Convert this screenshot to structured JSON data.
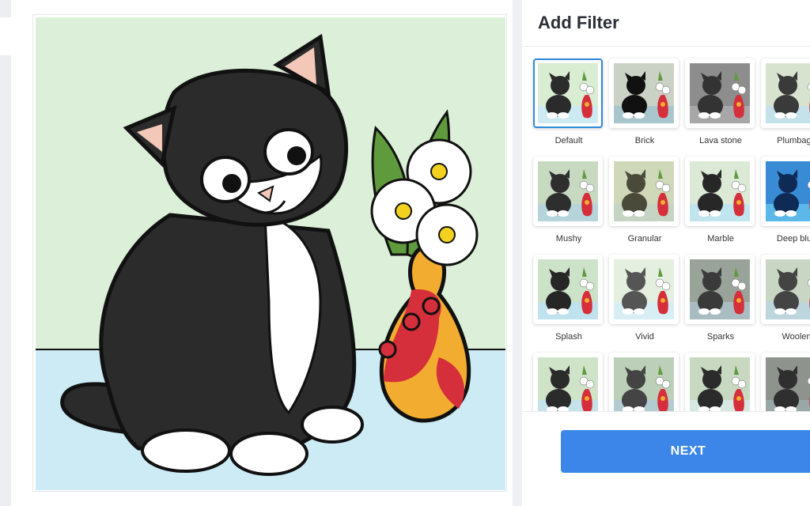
{
  "panel": {
    "title": "Add Filter",
    "next_label": "NEXT"
  },
  "filters": [
    {
      "label": "Default",
      "selected": true,
      "bg": "#d9edd3",
      "floor": "#cdeaf3",
      "cat": "#2b2b2b"
    },
    {
      "label": "Brick",
      "selected": false,
      "bg": "#c9d2c4",
      "floor": "#a9c6cf",
      "cat": "#111111"
    },
    {
      "label": "Lava stone",
      "selected": false,
      "bg": "#8d8d8d",
      "floor": "#a7a7a7",
      "cat": "#333333"
    },
    {
      "label": "Plumbage",
      "selected": false,
      "bg": "#d7e2cf",
      "floor": "#c5e1ea",
      "cat": "#3a3a3a"
    },
    {
      "label": "Mushy",
      "selected": false,
      "bg": "#c8d9c2",
      "floor": "#b6d4dc",
      "cat": "#2e2e2e"
    },
    {
      "label": "Granular",
      "selected": false,
      "bg": "#cfd8b9",
      "floor": "#c6d4c4",
      "cat": "#4a4a3a"
    },
    {
      "label": "Marble",
      "selected": false,
      "bg": "#dbe9d6",
      "floor": "#c1e5ee",
      "cat": "#272727"
    },
    {
      "label": "Deep blue",
      "selected": false,
      "bg": "#3a8bd6",
      "floor": "#5bb8e8",
      "cat": "#0f2a55"
    },
    {
      "label": "Splash",
      "selected": false,
      "bg": "#cde3c9",
      "floor": "#bfe2ee",
      "cat": "#262626"
    },
    {
      "label": "Vivid",
      "selected": false,
      "bg": "#e4efe0",
      "floor": "#d8eef5",
      "cat": "#555555"
    },
    {
      "label": "Sparks",
      "selected": false,
      "bg": "#9aa39a",
      "floor": "#a9bcc1",
      "cat": "#3a3a3a"
    },
    {
      "label": "Woolen",
      "selected": false,
      "bg": "#c9d6c4",
      "floor": "#bdd5dc",
      "cat": "#444444"
    },
    {
      "label": "",
      "selected": false,
      "bg": "#cfe3c9",
      "floor": "#c6e2ea",
      "cat": "#2b2b2b"
    },
    {
      "label": "",
      "selected": false,
      "bg": "#bccfb8",
      "floor": "#b3ccd2",
      "cat": "#444444"
    },
    {
      "label": "",
      "selected": false,
      "bg": "#c8d8c1",
      "floor": "#d7e8e2",
      "cat": "#2b2b2b"
    },
    {
      "label": "",
      "selected": false,
      "bg": "#8e948d",
      "floor": "#9aa7a9",
      "cat": "#2f2f2f"
    }
  ],
  "colors": {
    "accent": "#3b86e8",
    "selected_border": "#2f8bd8",
    "canvas_wall": "#dcefd8",
    "canvas_floor": "#cdebf5",
    "vase_red": "#d42f3a",
    "vase_orange": "#f2ad30",
    "leaf_green": "#5f9a3c",
    "flower_center": "#f2d21e"
  }
}
